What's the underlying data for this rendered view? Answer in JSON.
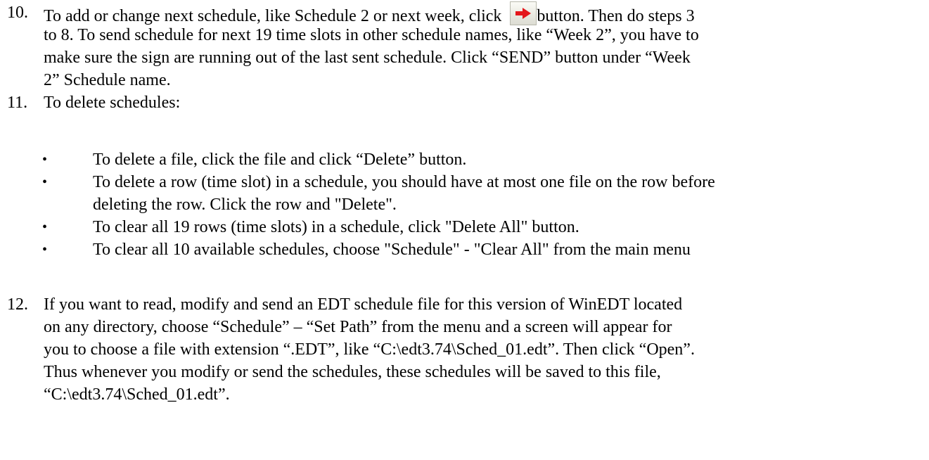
{
  "item10": {
    "number": "10.",
    "line1_before": "To add or change next schedule, like Schedule 2 or next week, click ",
    "line1_after": "button. Then do steps 3",
    "line2": "to 8. To send schedule for next 19 time slots in other schedule names, like “Week 2”, you have to",
    "line3": "make sure the sign are running out of the last sent schedule. Click “SEND” button under “Week",
    "line4": "2” Schedule name.",
    "button_icon": "red-right-arrow-icon"
  },
  "item11": {
    "number": "11.",
    "line1": "To delete schedules:",
    "bullets": [
      {
        "lines": [
          "To delete a file, click the file and click “Delete” button."
        ]
      },
      {
        "lines": [
          "To delete a row (time slot) in a schedule, you should have at most one file on the row before",
          "deleting the row. Click the row and \"Delete\"."
        ]
      },
      {
        "lines": [
          "To clear all 19 rows (time slots) in a schedule, click \"Delete All\" button."
        ]
      },
      {
        "lines": [
          "To clear all 10 available schedules, choose \"Schedule\" - \"Clear All\" from the main menu"
        ]
      }
    ],
    "bullet_glyph": "•"
  },
  "item12": {
    "number": "12.",
    "line1": "If you want to read, modify and send an EDT schedule file for this version of WinEDT located",
    "line2": "on any directory, choose “Schedule” – “Set Path” from the menu and a screen will appear for",
    "line3": "you to choose a file with extension “.EDT”, like “C:\\edt3.74\\Sched_01.edt”. Then click “Open”.",
    "line4": "Thus whenever you modify or send the schedules, these schedules will be saved to this file,",
    "line5": "“C:\\edt3.74\\Sched_01.edt”."
  },
  "colors": {
    "text": "#000000",
    "arrow": "#e4161b",
    "background": "#ffffff"
  }
}
